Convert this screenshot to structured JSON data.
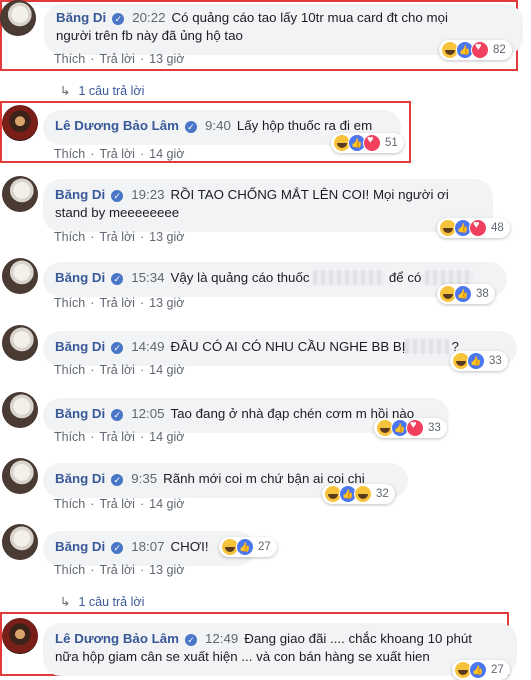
{
  "meta": {
    "verified_mark": "✓"
  },
  "comments": [
    {
      "name": "Băng Di",
      "time": "20:22",
      "text1": "Có quảng cáo tao lấy 10tr mua card đt cho mọi",
      "text2": "người trên fb này đã ủng hộ tao",
      "like": "Thích",
      "reply": "Trả lời",
      "age": "13 giờ",
      "reaction_count": "82"
    },
    {
      "replies_label": "1 câu trả lời"
    },
    {
      "name": "Lê Dương Bảo Lâm",
      "time": "9:40",
      "text1": "Lấy hộp thuốc ra đi em",
      "like": "Thích",
      "reply": "Trả lời",
      "age": "14 giờ",
      "reaction_count": "51"
    },
    {
      "name": "Băng Di",
      "time": "19:23",
      "text1": "RỒI TAO CHỐNG MẮT LÊN COI! Mọi người ơi",
      "text2": "stand by meeeeeeee",
      "like": "Thích",
      "reply": "Trả lời",
      "age": "13 giờ",
      "reaction_count": "48"
    },
    {
      "name": "Băng Di",
      "time": "15:34",
      "text1": "Vậy là quảng cáo thuốc",
      "text1b": "để có",
      "like": "Thích",
      "reply": "Trả lời",
      "age": "13 giờ",
      "reaction_count": "38"
    },
    {
      "name": "Băng Di",
      "time": "14:49",
      "text1": "ĐÂU CÓ AI CÓ NHU CẦU NGHE BB BỊ",
      "text1b": "?",
      "like": "Thích",
      "reply": "Trả lời",
      "age": "14 giờ",
      "reaction_count": "33"
    },
    {
      "name": "Băng Di",
      "time": "12:05",
      "text1": "Tao đang ở nhà đạp chén cơm m hồi nào",
      "like": "Thích",
      "reply": "Trả lời",
      "age": "14 giờ",
      "reaction_count": "33"
    },
    {
      "name": "Băng Di",
      "time": "9:35",
      "text1": "Rãnh mới coi m chứ bận ai coi chi",
      "like": "Thích",
      "reply": "Trả lời",
      "age": "14 giờ",
      "reaction_count": "32"
    },
    {
      "name": "Băng Di",
      "time": "18:07",
      "text1": "CHƠI!",
      "like": "Thích",
      "reply": "Trả lời",
      "age": "13 giờ",
      "reaction_count": "27"
    },
    {
      "replies_label": "1 câu trả lời"
    },
    {
      "name": "Lê Dương Bảo Lâm",
      "time": "12:49",
      "text1": "Đang giao đãi .... chắc khoang 10 phút",
      "text2": "nữa hộp giam cân se xuất hiện ... và con bán hàng se xuất hien",
      "reaction_count": "27"
    }
  ]
}
